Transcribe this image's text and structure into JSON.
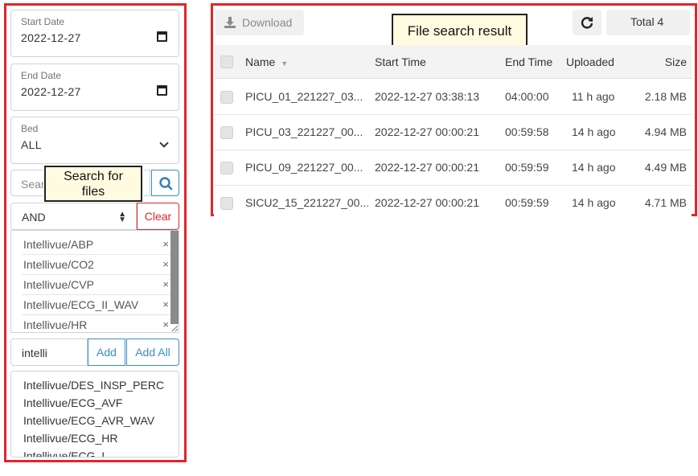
{
  "filters": {
    "start_date": {
      "label": "Start Date",
      "value": "2022-12-27",
      "icon": "calendar-icon"
    },
    "end_date": {
      "label": "End Date",
      "value": "2022-12-27",
      "icon": "calendar-icon"
    },
    "bed": {
      "label": "Bed",
      "value": "ALL",
      "icon": "chevron-down-icon"
    },
    "search": {
      "placeholder": "Sear",
      "icon": "search-icon"
    },
    "logic": {
      "value": "AND",
      "clear_label": "Clear"
    },
    "selected_tags": [
      {
        "label": "Intellivue/ABP",
        "remove": "×"
      },
      {
        "label": "Intellivue/CO2",
        "remove": "×"
      },
      {
        "label": "Intellivue/CVP",
        "remove": "×"
      },
      {
        "label": "Intellivue/ECG_II_WAV",
        "remove": "×"
      },
      {
        "label": "Intellivue/HR",
        "remove": "×"
      }
    ],
    "tag_input": {
      "value": "intelli",
      "add_label": "Add",
      "add_all_label": "Add All"
    },
    "options": [
      "Intellivue/DES_INSP_PERC",
      "Intellivue/ECG_AVF",
      "Intellivue/ECG_AVR_WAV",
      "Intellivue/ECG_HR",
      "Intellivue/ECG_I"
    ]
  },
  "annotations": {
    "search_callout": "Search for files",
    "result_callout": "File search result",
    "accent_red": "#e0262c"
  },
  "results": {
    "download_label": "Download",
    "download_icon": "download-icon",
    "refresh_icon": "refresh-icon",
    "total_label": "Total 4",
    "columns": {
      "name": "Name",
      "start": "Start Time",
      "end": "End Time",
      "uploaded": "Uploaded",
      "size": "Size"
    },
    "sort_icon": "sort-desc-icon",
    "rows": [
      {
        "name": "PICU_01_221227_03...",
        "start": "2022-12-27 03:38:13",
        "end": "04:00:00",
        "uploaded": "11 h ago",
        "size": "2.18 MB"
      },
      {
        "name": "PICU_03_221227_00...",
        "start": "2022-12-27 00:00:21",
        "end": "00:59:58",
        "uploaded": "14 h ago",
        "size": "4.94 MB"
      },
      {
        "name": "PICU_09_221227_00...",
        "start": "2022-12-27 00:00:21",
        "end": "00:59:59",
        "uploaded": "14 h ago",
        "size": "4.49 MB"
      },
      {
        "name": "SICU2_15_221227_00...",
        "start": "2022-12-27 00:00:21",
        "end": "00:59:59",
        "uploaded": "14 h ago",
        "size": "4.71 MB"
      }
    ]
  }
}
